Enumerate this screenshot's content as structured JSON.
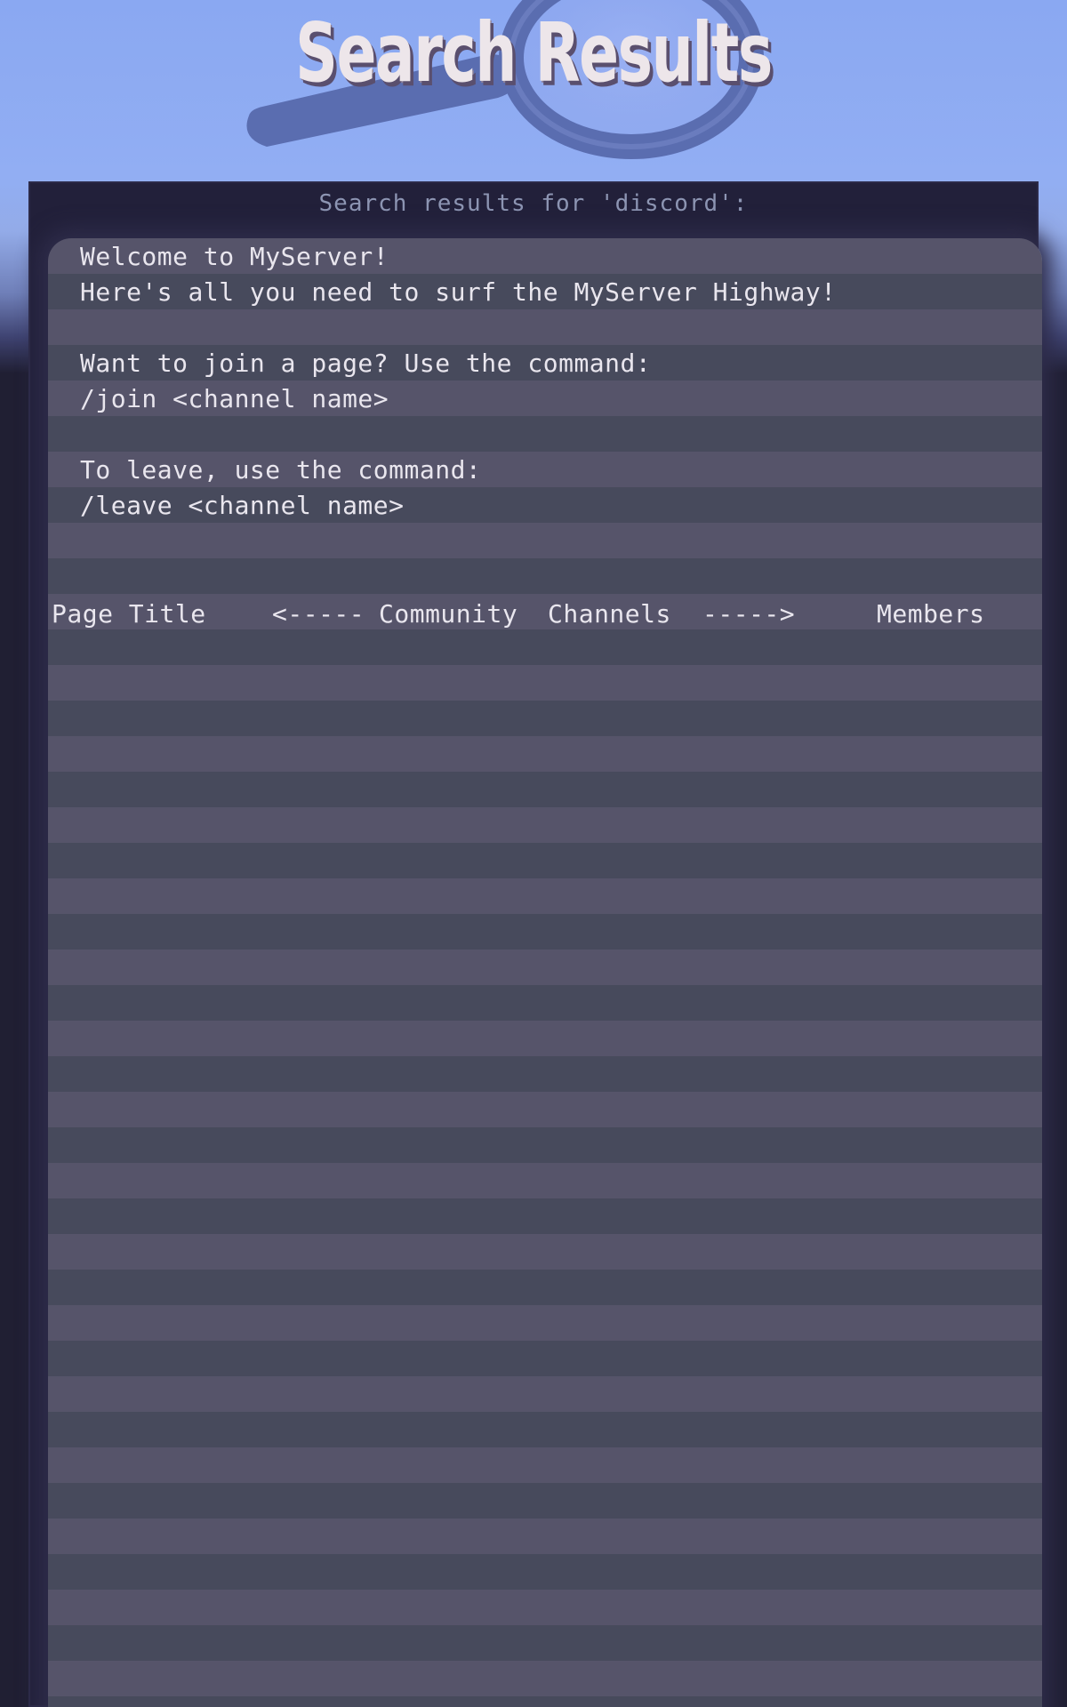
{
  "header": {
    "title": "Search Results"
  },
  "search": {
    "caption": "Search results for 'discord':"
  },
  "welcome": {
    "line1": "Welcome to MyServer!",
    "line2": "Here's all you need to surf the MyServer Highway!",
    "line3": "Want to join a page? Use the command:",
    "line4": "/join <channel name>",
    "line5": "To leave, use the command:",
    "line6": "/leave <channel name>"
  },
  "table": {
    "col_page_title": "Page Title",
    "col_arrow_left": "<-----",
    "col_community": "Community",
    "col_channels": "Channels",
    "col_arrow_right": "----->",
    "col_members": "Members"
  },
  "colors": {
    "sky": "#8aa8f2",
    "panel": "#22203a",
    "stripe_light": "#56546a",
    "stripe_dark": "#474a5c",
    "text": "#e9e6ee",
    "caption": "#8d95b3"
  }
}
